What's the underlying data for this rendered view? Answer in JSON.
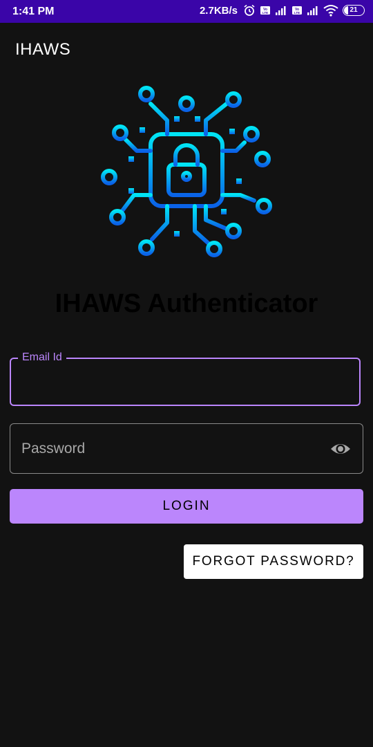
{
  "status_bar": {
    "time": "1:41 PM",
    "net_speed": "2.7KB/s",
    "battery_level": "21",
    "icons": [
      "alarm-icon",
      "volte-icon",
      "signal-icon",
      "volte-icon",
      "signal-icon",
      "wifi-icon",
      "battery-icon"
    ]
  },
  "app_bar": {
    "title": "IHAWS"
  },
  "logo": {
    "icon": "circuit-lock-icon",
    "gradient_top": "#00e5f5",
    "gradient_bottom": "#0a62e8"
  },
  "headline": "IHAWS Authenticator",
  "form": {
    "email_label": "Email Id",
    "email_value": "",
    "password_placeholder": "Password",
    "password_toggle_icon": "eye-icon",
    "accent_color": "#bb86fc"
  },
  "buttons": {
    "login": "LOGIN",
    "forgot_password": "FORGOT PASSWORD?"
  }
}
